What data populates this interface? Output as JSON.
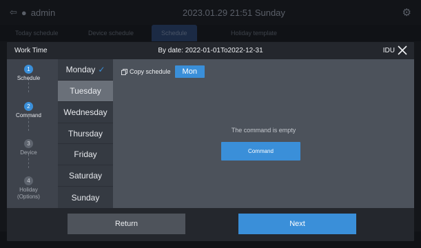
{
  "background": {
    "user_name": "admin",
    "datetime": "2023.01.29 21:51 Sunday",
    "tabs": [
      "Today schedule",
      "Device schedule",
      "Schedule",
      "Holiday template"
    ]
  },
  "modal": {
    "title": "Work Time",
    "by_date": "By date: 2022-01-01To2022-12-31",
    "idu_label": "IDU"
  },
  "steps": [
    {
      "number": "1",
      "label": "Schedule",
      "state": "done"
    },
    {
      "number": "2",
      "label": "Command",
      "state": "done"
    },
    {
      "number": "3",
      "label": "Device",
      "state": "todo"
    },
    {
      "number": "4",
      "label": "Holiday\n(Options)",
      "state": "todo"
    }
  ],
  "days": [
    {
      "label": "Monday",
      "checked": true,
      "selected": false
    },
    {
      "label": "Tuesday",
      "checked": false,
      "selected": true
    },
    {
      "label": "Wednesday",
      "checked": false,
      "selected": false
    },
    {
      "label": "Thursday",
      "checked": false,
      "selected": false
    },
    {
      "label": "Friday",
      "checked": false,
      "selected": false
    },
    {
      "label": "Saturday",
      "checked": false,
      "selected": false
    },
    {
      "label": "Sunday",
      "checked": false,
      "selected": false
    }
  ],
  "content": {
    "copy_label": "Copy schedule",
    "copy_source": "Mon",
    "empty_message": "The command is empty",
    "command_button": "Command"
  },
  "footer": {
    "return_label": "Return",
    "next_label": "Next"
  },
  "colors": {
    "accent": "#3a8fd9",
    "header": "#24272d",
    "panel": "#4c525b"
  }
}
